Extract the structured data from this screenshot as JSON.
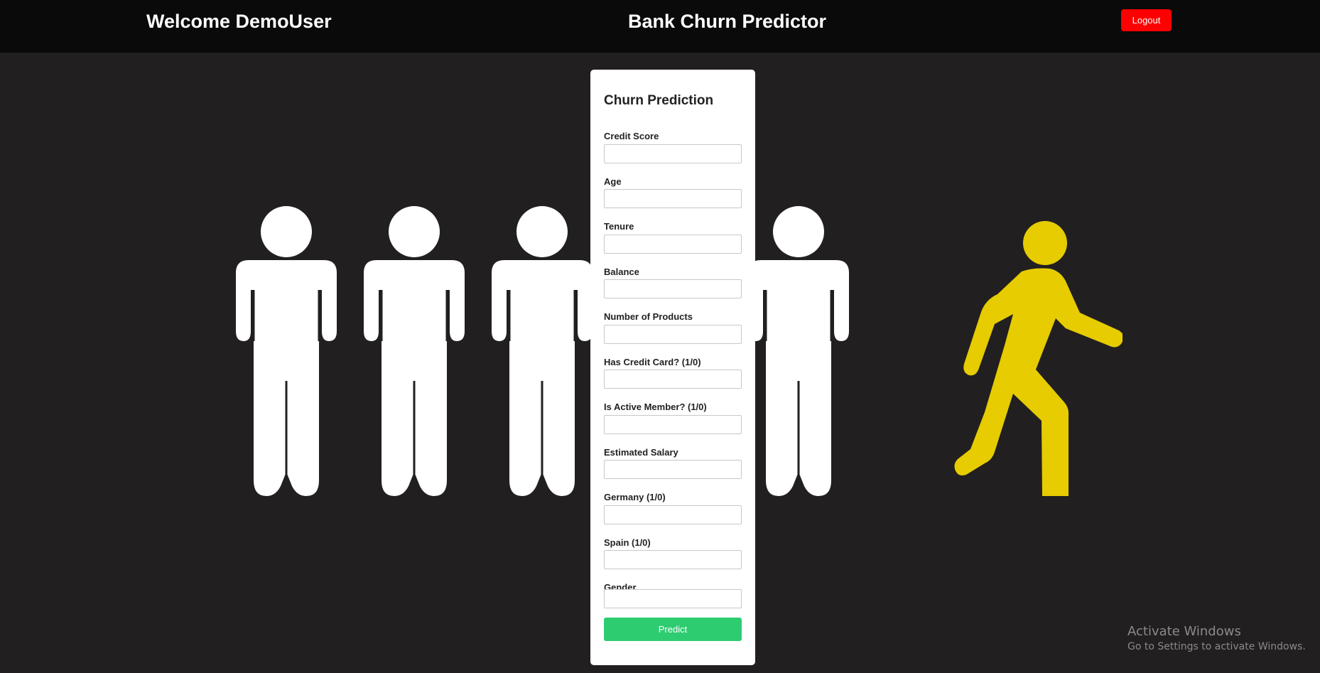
{
  "header": {
    "welcome": "Welcome DemoUser",
    "title": "Bank Churn Predictor",
    "logout_label": "Logout"
  },
  "form": {
    "title": "Churn Prediction",
    "fields": [
      {
        "label": "Credit Score",
        "value": ""
      },
      {
        "label": "Age",
        "value": ""
      },
      {
        "label": "Tenure",
        "value": ""
      },
      {
        "label": "Balance",
        "value": ""
      },
      {
        "label": "Number of Products",
        "value": ""
      },
      {
        "label": "Has Credit Card? (1/0)",
        "value": ""
      },
      {
        "label": "Is Active Member? (1/0)",
        "value": ""
      },
      {
        "label": "Estimated Salary",
        "value": ""
      },
      {
        "label": "Germany (1/0)",
        "value": ""
      },
      {
        "label": "Spain (1/0)",
        "value": ""
      },
      {
        "label": "Gender",
        "value": ""
      }
    ],
    "predict_label": "Predict"
  },
  "background": {
    "standing_icon": "person-standing-icon",
    "walking_icon": "person-walking-away-icon",
    "standing_color": "#ffffff",
    "walking_color": "#e6cc00"
  },
  "watermark": {
    "line1": "Activate Windows",
    "line2": "Go to Settings to activate Windows."
  },
  "colors": {
    "page_bg": "#221f20",
    "topbar_bg": "#0a0a0a",
    "logout_bg": "#ff0000",
    "predict_bg": "#2ecc71"
  }
}
